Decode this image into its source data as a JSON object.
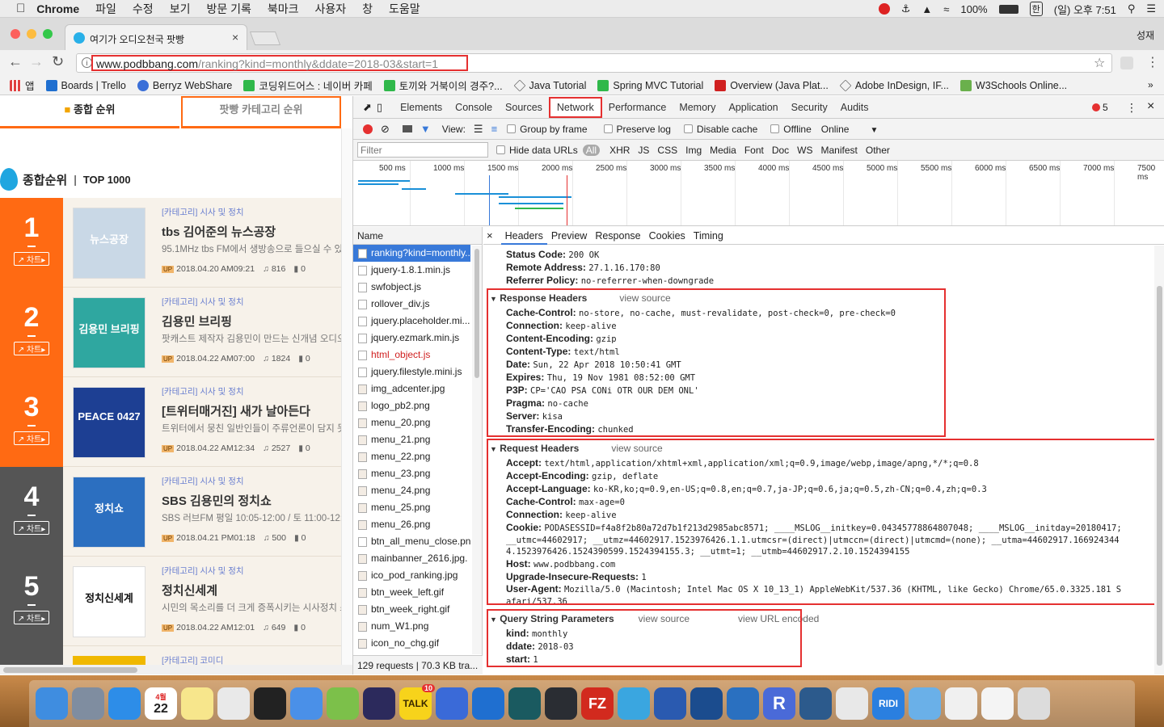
{
  "menubar": {
    "apple": "",
    "items": [
      "Chrome",
      "파일",
      "수정",
      "보기",
      "방문 기록",
      "북마크",
      "사용자",
      "창",
      "도움말"
    ],
    "battery": "100%",
    "input_method": "한",
    "clock": "(일) 오후 7:51"
  },
  "browser": {
    "tab_title": "여기가 오디오천국 팟빵",
    "profile": "성재",
    "url_host": "www.podbbang.com",
    "url_path": "/ranking?kind=monthly&ddate=2018-03&start=1",
    "bookmarks": [
      "앱",
      "Boards | Trello",
      "Berryz WebShare",
      "코딩위드어스 : 네이버 카페",
      "토끼와 거북이의 경주?...",
      "Java Tutorial",
      "Spring MVC Tutorial",
      "Overview (Java Plat...",
      "Adobe InDesign, IF...",
      "W3Schools Online..."
    ],
    "bookmark_colors": [
      "#e04040",
      "#1f6fd0",
      "#3a6fd8",
      "#2fb84a",
      "#2fb84a",
      "#666666",
      "#2fb84a",
      "#d02020",
      "#666666",
      "#6ab04c"
    ]
  },
  "page": {
    "tab_overall": "종합 순위",
    "tab_category": "팟빵 카테고리 순위",
    "section_title": "종합순위",
    "section_sub": "TOP 1000",
    "chart_label": "차트",
    "rows": [
      {
        "rank": "1",
        "color": "#ff6a13",
        "category": "[카테고리] 시사 및 정치",
        "title": "tbs 김어준의 뉴스공장",
        "desc": "95.1MHz tbs FM에서 생방송으로 들으실 수 있습",
        "date": "2018.04.20 AM09:21",
        "plays": "816",
        "comments": "0",
        "thumb_color": "#c9d8e6",
        "thumb_text": "뉴스공장"
      },
      {
        "rank": "2",
        "color": "#ff6a13",
        "category": "[카테고리] 시사 및 정치",
        "title": "김용민 브리핑",
        "desc": "팟캐스트 제작자 김용민이 만드는 신개념 오디오",
        "date": "2018.04.22 AM07:00",
        "plays": "1824",
        "comments": "0",
        "thumb_color": "#2fa7a0",
        "thumb_text": "김용민 브리핑"
      },
      {
        "rank": "3",
        "color": "#ff6a13",
        "category": "[카테고리] 시사 및 정치",
        "title": "[트위터매거진] 새가 날아든다",
        "desc": "트위터에서 뭉친 일반인들이 주류언론이 담지 못",
        "date": "2018.04.22 AM12:34",
        "plays": "2527",
        "comments": "0",
        "thumb_color": "#1d3f93",
        "thumb_text": "PEACE 0427"
      },
      {
        "rank": "4",
        "color": "#555555",
        "category": "[카테고리] 시사 및 정치",
        "title": "SBS 김용민의 정치쇼",
        "desc": "SBS 러브FM 평일 10:05-12:00 / 토 11:00-12:00",
        "date": "2018.04.21 PM01:18",
        "plays": "500",
        "comments": "0",
        "thumb_color": "#2c6fc0",
        "thumb_text": "정치쇼"
      },
      {
        "rank": "5",
        "color": "#555555",
        "category": "[카테고리] 시사 및 정치",
        "title": "정치신세계",
        "desc": "시민의 목소리를 더 크게 증폭시키는 시사정치 스",
        "date": "2018.04.22 AM12:01",
        "plays": "649",
        "comments": "0",
        "thumb_color": "#ffffff",
        "thumb_text": "정치신세계"
      }
    ],
    "next_category": "[카테고리] 코미디"
  },
  "devtools": {
    "tabs": [
      "Elements",
      "Console",
      "Sources",
      "Network",
      "Performance",
      "Memory",
      "Application",
      "Security",
      "Audits"
    ],
    "active_tab": "Network",
    "error_count": "5",
    "toolbar": {
      "view": "View:",
      "group_by_frame": "Group by frame",
      "preserve_log": "Preserve log",
      "disable_cache": "Disable cache",
      "offline": "Offline",
      "throttle": "Online"
    },
    "filter_placeholder": "Filter",
    "hide_data_urls": "Hide data URLs",
    "types": [
      "All",
      "XHR",
      "JS",
      "CSS",
      "Img",
      "Media",
      "Font",
      "Doc",
      "WS",
      "Manifest",
      "Other"
    ],
    "ticks": [
      "500 ms",
      "1000 ms",
      "1500 ms",
      "2000 ms",
      "2500 ms",
      "3000 ms",
      "3500 ms",
      "4000 ms",
      "4500 ms",
      "5000 ms",
      "5500 ms",
      "6000 ms",
      "6500 ms",
      "7000 ms",
      "7500 ms"
    ],
    "name_header": "Name",
    "requests": [
      "ranking?kind=monthly...",
      "jquery-1.8.1.min.js",
      "swfobject.js",
      "rollover_div.js",
      "jquery.placeholder.mi...",
      "jquery.ezmark.min.js",
      "html_object.js",
      "jquery.filestyle.mini.js",
      "img_adcenter.jpg",
      "logo_pb2.png",
      "menu_20.png",
      "menu_21.png",
      "menu_22.png",
      "menu_23.png",
      "menu_24.png",
      "menu_25.png",
      "menu_26.png",
      "btn_all_menu_close.pn",
      "mainbanner_2616.jpg.",
      "ico_pod_ranking.jpg",
      "btn_week_left.gif",
      "btn_week_right.gif",
      "num_W1.png",
      "icon_no_chg.gif"
    ],
    "footer": "129 requests | 70.3 KB tra...",
    "detail_tabs": [
      "Headers",
      "Preview",
      "Response",
      "Cookies",
      "Timing"
    ],
    "general": [
      {
        "k": "Status Code:",
        "v": "200 OK"
      },
      {
        "k": "Remote Address:",
        "v": "27.1.16.170:80"
      },
      {
        "k": "Referrer Policy:",
        "v": "no-referrer-when-downgrade"
      }
    ],
    "response_headers_title": "Response Headers",
    "view_source": "view source",
    "response_headers": [
      {
        "k": "Cache-Control:",
        "v": "no-store, no-cache, must-revalidate, post-check=0, pre-check=0"
      },
      {
        "k": "Connection:",
        "v": "keep-alive"
      },
      {
        "k": "Content-Encoding:",
        "v": "gzip"
      },
      {
        "k": "Content-Type:",
        "v": "text/html"
      },
      {
        "k": "Date:",
        "v": "Sun, 22 Apr 2018 10:50:41 GMT"
      },
      {
        "k": "Expires:",
        "v": "Thu, 19 Nov 1981 08:52:00 GMT"
      },
      {
        "k": "P3P:",
        "v": "CP='CAO PSA CONi OTR OUR DEM ONL'"
      },
      {
        "k": "Pragma:",
        "v": "no-cache"
      },
      {
        "k": "Server:",
        "v": "kisa"
      },
      {
        "k": "Transfer-Encoding:",
        "v": "chunked"
      }
    ],
    "request_headers_title": "Request Headers",
    "request_headers": [
      {
        "k": "Accept:",
        "v": "text/html,application/xhtml+xml,application/xml;q=0.9,image/webp,image/apng,*/*;q=0.8"
      },
      {
        "k": "Accept-Encoding:",
        "v": "gzip, deflate"
      },
      {
        "k": "Accept-Language:",
        "v": "ko-KR,ko;q=0.9,en-US;q=0.8,en;q=0.7,ja-JP;q=0.6,ja;q=0.5,zh-CN;q=0.4,zh;q=0.3"
      },
      {
        "k": "Cache-Control:",
        "v": "max-age=0"
      },
      {
        "k": "Connection:",
        "v": "keep-alive"
      },
      {
        "k": "Cookie:",
        "v": "PODASESSID=f4a8f2b80a72d7b1f213d2985abc8571; ____MSLOG__initkey=0.04345778864807048; ____MSLOG__initday=20180417;"
      },
      {
        "k": "",
        "v": "__utmc=44602917; __utmz=44602917.1523976426.1.1.utmcsr=(direct)|utmccn=(direct)|utmcmd=(none); __utma=44602917.166924344"
      },
      {
        "k": "",
        "v": "4.1523976426.1524390599.1524394155.3; __utmt=1; __utmb=44602917.2.10.1524394155"
      },
      {
        "k": "Host:",
        "v": "www.podbbang.com"
      },
      {
        "k": "Upgrade-Insecure-Requests:",
        "v": "1"
      },
      {
        "k": "User-Agent:",
        "v": "Mozilla/5.0 (Macintosh; Intel Mac OS X 10_13_1) AppleWebKit/537.36 (KHTML, like Gecko) Chrome/65.0.3325.181 S"
      },
      {
        "k": "",
        "v": "afari/537.36"
      }
    ],
    "query_title": "Query String Parameters",
    "view_url_encoded": "view URL encoded",
    "query_params": [
      {
        "k": "kind:",
        "v": "monthly"
      },
      {
        "k": "ddate:",
        "v": "2018-03"
      },
      {
        "k": "start:",
        "v": "1"
      }
    ]
  },
  "dock": {
    "calendar_month": "4월",
    "calendar_day": "22",
    "talk_badge": "10",
    "ridi": "RIDI",
    "apps": [
      "finder",
      "launchpad",
      "safari",
      "calendar",
      "notes",
      "preview",
      "terminal",
      "xcode",
      "android-studio",
      "eclipse",
      "kakaotalk",
      "instastats",
      "trello",
      "gitkraken",
      "atom",
      "filezilla",
      "docker",
      "word",
      "sourcetree",
      "vscode",
      "r",
      "mysql-workbench",
      "chrome",
      "ridibooks",
      "folder",
      "screenshot",
      "document",
      "trash"
    ]
  }
}
